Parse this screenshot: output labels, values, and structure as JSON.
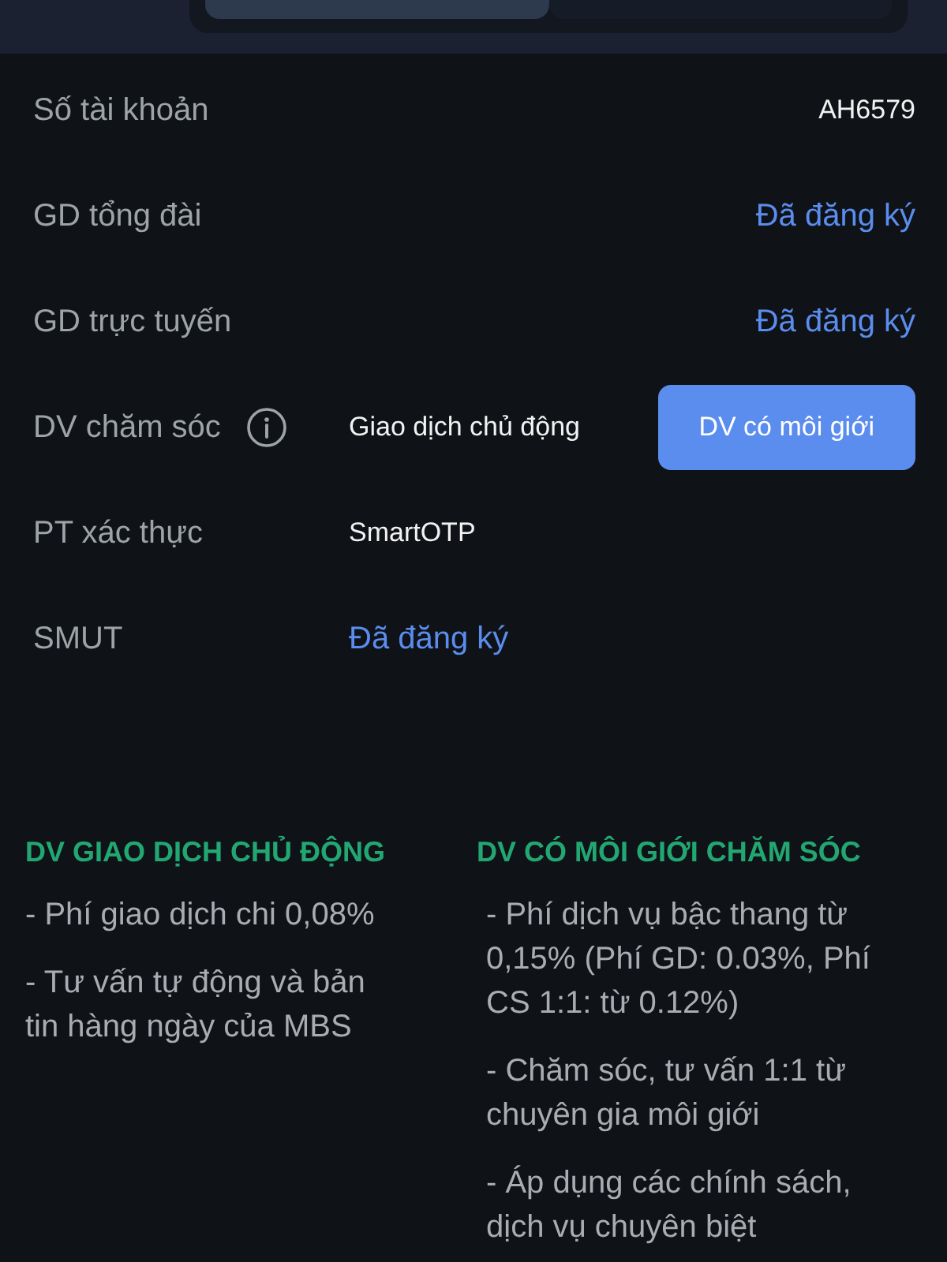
{
  "tabs": [
    {
      "selected": true
    },
    {
      "selected": false
    }
  ],
  "rows": [
    {
      "label": "Số tài khoản",
      "kind": "value",
      "value": "AH6579"
    },
    {
      "label": "GD tổng đài",
      "kind": "status",
      "value": "Đã đăng ký"
    },
    {
      "label": "GD trực tuyến",
      "kind": "status",
      "value": "Đã đăng ký"
    },
    {
      "label": "DV chăm sóc",
      "kind": "choice",
      "options": [
        {
          "label": "Giao dịch chủ động",
          "selected": false
        },
        {
          "label": "DV có môi giới",
          "selected": true
        }
      ]
    },
    {
      "label": "PT xác thực",
      "kind": "plain",
      "value": "SmartOTP"
    },
    {
      "label": "SMUT",
      "kind": "link",
      "value": "Đã đăng ký"
    }
  ],
  "services": [
    {
      "title": "DV GIAO DỊCH CHỦ ĐỘNG",
      "items": [
        "- Phí giao dịch chi 0,08%",
        "- Tư vấn tự động và bản tin hàng ngày của MBS"
      ]
    },
    {
      "title": "DV CÓ MÔI GIỚI CHĂM SÓC",
      "items": [
        "- Phí dịch vụ bậc thang từ 0,15% (Phí GD: 0.03%, Phí CS 1:1: từ 0.12%)",
        "- Chăm sóc, tư vấn 1:1 từ chuyên gia môi giới",
        "- Áp dụng các chính sách, dịch vụ chuyên biệt"
      ]
    }
  ]
}
